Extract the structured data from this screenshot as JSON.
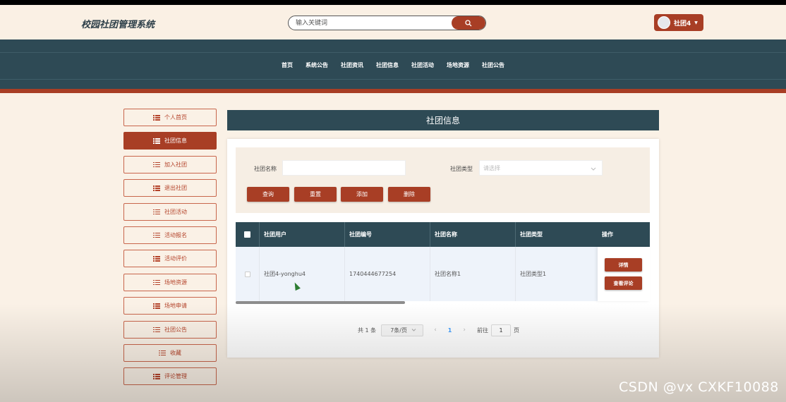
{
  "header": {
    "brand": "校园社团管理系统",
    "search_placeholder": "输入关键词",
    "user_label": "社团4"
  },
  "nav": {
    "items": [
      "首页",
      "系统公告",
      "社团资讯",
      "社团信息",
      "社团活动",
      "场地资源",
      "社团公告"
    ]
  },
  "sidebar": {
    "items": [
      {
        "label": "个人首页"
      },
      {
        "label": "社团信息"
      },
      {
        "label": "加入社团"
      },
      {
        "label": "退出社团"
      },
      {
        "label": "社团活动"
      },
      {
        "label": "活动报名"
      },
      {
        "label": "活动评价"
      },
      {
        "label": "场地资源"
      },
      {
        "label": "场地申请"
      },
      {
        "label": "社团公告"
      },
      {
        "label": "收藏"
      },
      {
        "label": "评论管理"
      }
    ],
    "active_index": 1
  },
  "main": {
    "title": "社团信息",
    "filter": {
      "name_label": "社团名称",
      "name_value": "",
      "type_label": "社团类型",
      "type_placeholder": "请选择",
      "buttons": {
        "query": "查询",
        "reset": "重置",
        "add": "添加",
        "delete": "删除"
      }
    },
    "table": {
      "headers": [
        "社团用户",
        "社团编号",
        "社团名称",
        "社团类型",
        "操作"
      ],
      "rows": [
        {
          "user": "社团4-yonghu4",
          "code": "1740444677254",
          "name": "社团名称1",
          "type": "社团类型1"
        }
      ],
      "row_actions": {
        "detail": "详情",
        "comments": "查看评论"
      }
    },
    "pagination": {
      "total": "共 1 条",
      "page_size": "7条/页",
      "current_page": "1",
      "goto_label": "前往",
      "goto_value": "1",
      "page_suffix": "页"
    }
  },
  "watermark": "CSDN @vx  CXKF10088",
  "colors": {
    "accent": "#a83e25",
    "dark": "#2e4a55",
    "background": "#faf1e6"
  }
}
